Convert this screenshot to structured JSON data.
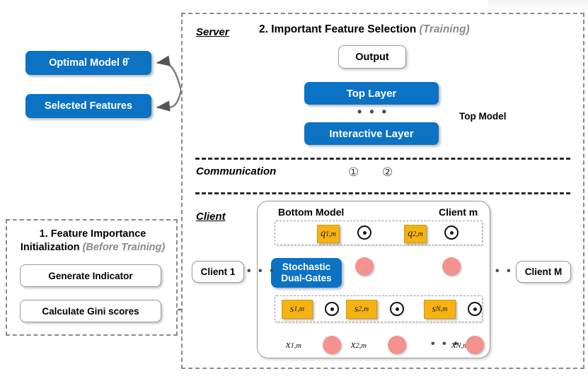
{
  "diagram": {
    "title_server_phase": "2. Important Feature Selection",
    "title_server_phase_sub": "(Training)",
    "title_init_phase_line1": "1. Feature Importance",
    "title_init_phase_line2": "Initialization",
    "title_init_phase_sub": "(Before Training)",
    "colors": {
      "blue": "#0B72C4",
      "orange": "#F5B212",
      "pink": "#F5918E",
      "dashed_border": "#8a8a8a",
      "sub_text_gray": "#8a8a8a"
    }
  },
  "sections": {
    "server_label": "Server",
    "communication_label": "Communication",
    "client_label": "Client"
  },
  "server": {
    "output_box": "Output",
    "top_layer": "Top Layer",
    "ellipsis": "• • •",
    "interactive_layer": "Interactive Layer",
    "top_model_label": "Top Model"
  },
  "outputs": {
    "optimal_model": "Optimal Model θ̂",
    "selected_features": "Selected Features"
  },
  "communication": {
    "marker_up": "①",
    "marker_down": "②"
  },
  "client": {
    "bottom_model_label": "Bottom Model",
    "client_m_label": "Client m",
    "client_first_label": "Client 1",
    "client_last_label": "Client M",
    "stochastic_dual_gates_line1": "Stochastic",
    "stochastic_dual_gates_line2": "Dual-Gates",
    "ellipsis_between_clients": "• • •",
    "ellipsis_features": "• • •",
    "q_gates": [
      {
        "base": "q",
        "sub": "1,m"
      },
      {
        "base": "q",
        "sub": "2,m"
      }
    ],
    "s_gates": [
      {
        "base": "s",
        "sub": "1,m"
      },
      {
        "base": "s",
        "sub": "2,m"
      },
      {
        "base": "s",
        "sub": "N,m"
      }
    ],
    "inputs": [
      {
        "base": "x",
        "sub": "1,m"
      },
      {
        "base": "x",
        "sub": "2,m"
      },
      {
        "base": "x",
        "sub": "N,m"
      }
    ],
    "operator_symbol": "⊙"
  },
  "initialization": {
    "generate_indicator": "Generate Indicator",
    "calculate_gini": "Calculate Gini scores"
  }
}
